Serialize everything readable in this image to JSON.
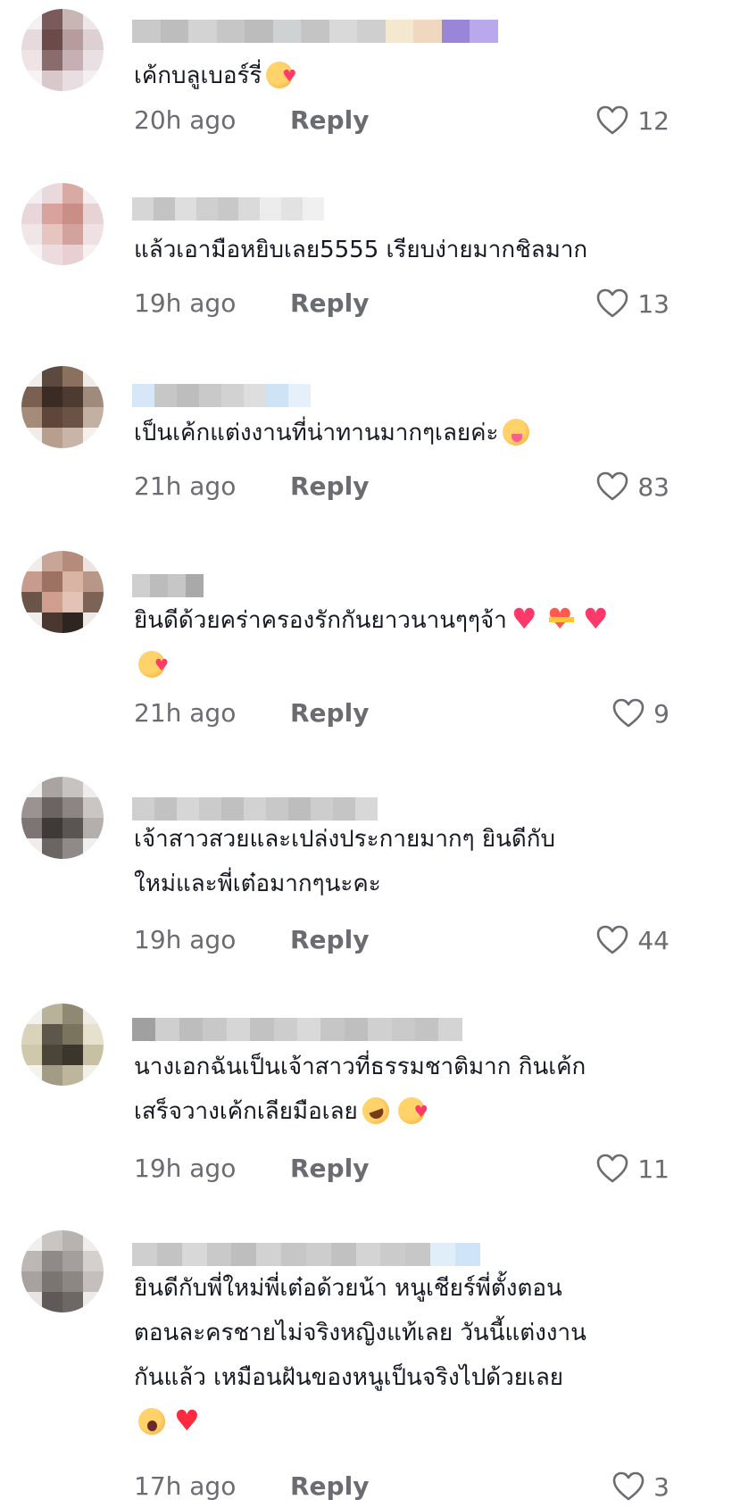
{
  "comments": [
    {
      "text_lines": [
        "เค้กบลูเบอร์รี่"
      ],
      "emoji_lines": [
        [
          "smiling-face-with-hearts"
        ]
      ],
      "time": "20h ago",
      "reply_label": "Reply",
      "likes": "12",
      "avatar_colors": [
        "#f6f0f2",
        "#7a5a5a",
        "#c8b5b5",
        "#efe6e9",
        "#e6dadd",
        "#6b4a49",
        "#b69c9d",
        "#ddd0d3",
        "#efe3e6",
        "#8a6c6c",
        "#c7b0b3",
        "#e9e0e3",
        "#f7f3f4",
        "#d9c8cb",
        "#e8dde0",
        "#f4eef0"
      ],
      "name_colors": [
        "#c9c9c9",
        "#bdbdbd",
        "#d3d3d3",
        "#c6c6c6",
        "#bcbcbc",
        "#cfd2d2",
        "#c4c4c4",
        "#d9d9d9",
        "#cfcfcf",
        "#f4e8d0",
        "#f0d8c0",
        "#9a86d8",
        "#b9a8ec"
      ]
    },
    {
      "text_lines": [
        "แล้วเอามือหยิบเลย5555 เรียบง่ายมากชิลมาก"
      ],
      "emoji_lines": [
        []
      ],
      "time": "19h ago",
      "reply_label": "Reply",
      "likes": "13",
      "avatar_colors": [
        "#f3eef0",
        "#e9d8dc",
        "#d9a9a3",
        "#f5eef0",
        "#e8d6d9",
        "#d8a39c",
        "#c98e86",
        "#e7d2d4",
        "#f0e6e8",
        "#e6c4bf",
        "#d3a29c",
        "#efe1e3",
        "#f8f4f5",
        "#eddcdf",
        "#e8d0d2",
        "#f6f0f1"
      ],
      "name_colors": [
        "#d6d6d6",
        "#c3c3c3",
        "#dedede",
        "#cfcfcf",
        "#c8c8c8",
        "#dadada",
        "#ececec",
        "#e2e2e2",
        "#f0f0f0"
      ]
    },
    {
      "text_lines": [
        "เป็นเค้กแต่งงานที่น่าทานมากๆเลยค่ะ"
      ],
      "emoji_lines": [
        [
          "face-savoring-food"
        ]
      ],
      "time": "21h ago",
      "reply_label": "Reply",
      "likes": "83",
      "avatar_colors": [
        "#f3eeec",
        "#5c4a40",
        "#8a705f",
        "#f1ebe8",
        "#7a6050",
        "#3a2c25",
        "#4d3b31",
        "#a08a7c",
        "#a58c7a",
        "#5e473a",
        "#6a5245",
        "#c2b0a3",
        "#f2ece9",
        "#b89f8d",
        "#c8b5a8",
        "#f5f0ee"
      ],
      "name_colors": [
        "#d6e8f8",
        "#c7c7c7",
        "#bdbdbd",
        "#c9c9c9",
        "#d2d2d2",
        "#dedede",
        "#cfe3f6",
        "#e6f0fa"
      ]
    },
    {
      "text_lines": [
        "ยินดีด้วยคร่าครองรักกันยาวนานๆๆจ้า",
        ""
      ],
      "emoji_lines": [
        [
          "sparkling-heart",
          "heart-with-ribbon",
          "sparkling-heart"
        ],
        [
          "smiling-face-with-hearts"
        ]
      ],
      "time": "21h ago",
      "reply_label": "Reply",
      "likes": "9",
      "avatar_colors": [
        "#f1ebe9",
        "#c9a597",
        "#b58b7c",
        "#ece3e0",
        "#c79c8e",
        "#9e7262",
        "#d9b3a4",
        "#b89788",
        "#6a5448",
        "#cf9e8d",
        "#e2c3b5",
        "#7b6356",
        "#f2ecea",
        "#4a3830",
        "#2e2420",
        "#efe8e6"
      ],
      "name_colors": [
        "#cfcfcf",
        "#bcbcbc",
        "#c6c6c6",
        "#a9a9a9"
      ]
    },
    {
      "text_lines": [
        "เจ้าสาวสวยและเปล่งประกายมากๆ ยินดีกับ",
        "ใหม่และพี่เต๋อมากๆนะคะ"
      ],
      "emoji_lines": [
        [],
        []
      ],
      "time": "19h ago",
      "reply_label": "Reply",
      "likes": "44",
      "avatar_colors": [
        "#f3f1f0",
        "#a9a4a2",
        "#c7c3c1",
        "#efedec",
        "#9a9391",
        "#6b6462",
        "#8d8583",
        "#c9c5c3",
        "#7c7573",
        "#3f3a38",
        "#5a5452",
        "#b4afad",
        "#efedec",
        "#6a6462",
        "#8f8987",
        "#f1efee"
      ],
      "name_colors": [
        "#cfcfcf",
        "#c2c2c2",
        "#d6d6d6",
        "#cbcbcb",
        "#c0c0c0",
        "#d2d2d2",
        "#c8c8c8",
        "#bdbdbd",
        "#cdcdcd",
        "#c5c5c5",
        "#d8d8d8"
      ]
    },
    {
      "text_lines": [
        "นางเอกฉันเป็นเจ้าสาวที่ธรรมชาติมาก กินเค้ก",
        "เสร็จวางเค้กเลียมือเลย"
      ],
      "emoji_lines": [
        [],
        [
          "rolling-laughing",
          "smiling-face-with-hearts"
        ]
      ],
      "time": "19h ago",
      "reply_label": "Reply",
      "likes": "11",
      "avatar_colors": [
        "#f3f2ec",
        "#b9b29a",
        "#8f8873",
        "#eeece4",
        "#d9d3bc",
        "#5c574a",
        "#7a745f",
        "#e6e1cd",
        "#cfc8ad",
        "#4a4538",
        "#3a362c",
        "#c7c0a5",
        "#f4f3ed",
        "#a39c84",
        "#bdb69c",
        "#f1efe7"
      ],
      "name_colors": [
        "#a0a0a0",
        "#cfcfcf",
        "#bdbdbd",
        "#c8c8c8",
        "#d6d6d6",
        "#c2c2c2",
        "#cdcdcd",
        "#d9d9d9",
        "#c6c6c6",
        "#bfbfbf",
        "#d0d0d0",
        "#cacaca",
        "#c3c3c3",
        "#d4d4d4"
      ]
    },
    {
      "text_lines": [
        "ยินดีกับพี่ใหม่พี่เต๋อด้วยน้า หนูเชียร์พี่ตั้งตอน",
        "ตอนละครชายไม่จริงหญิงแท้เลย วันนี้แต่งงาน",
        "กันแล้ว เหมือนฝันของหนูเป็นจริงไปด้วยเลย",
        ""
      ],
      "emoji_lines": [
        [],
        [],
        [],
        [
          "loudly-crying",
          "red-heart"
        ]
      ],
      "time": "17h ago",
      "reply_label": "Reply",
      "likes": "3",
      "avatar_colors": [
        "#f1efee",
        "#c9c5c3",
        "#b8b3b1",
        "#efedec",
        "#bdb8b6",
        "#8f8987",
        "#a49e9c",
        "#d4d0ce",
        "#a7a19f",
        "#7b7572",
        "#8d8784",
        "#c4bfbd",
        "#e7e4e3",
        "#5f5957",
        "#6e6865",
        "#eeeceb"
      ],
      "name_colors": [
        "#cfcfcf",
        "#c3c3c3",
        "#d8d8d8",
        "#c9c9c9",
        "#bebebe",
        "#d2d2d2",
        "#c6c6c6",
        "#cdcdcd",
        "#c1c1c1",
        "#d4d4d4",
        "#cbcbcb",
        "#c7c7c7",
        "#dfeef9",
        "#cfe4f6"
      ]
    }
  ]
}
